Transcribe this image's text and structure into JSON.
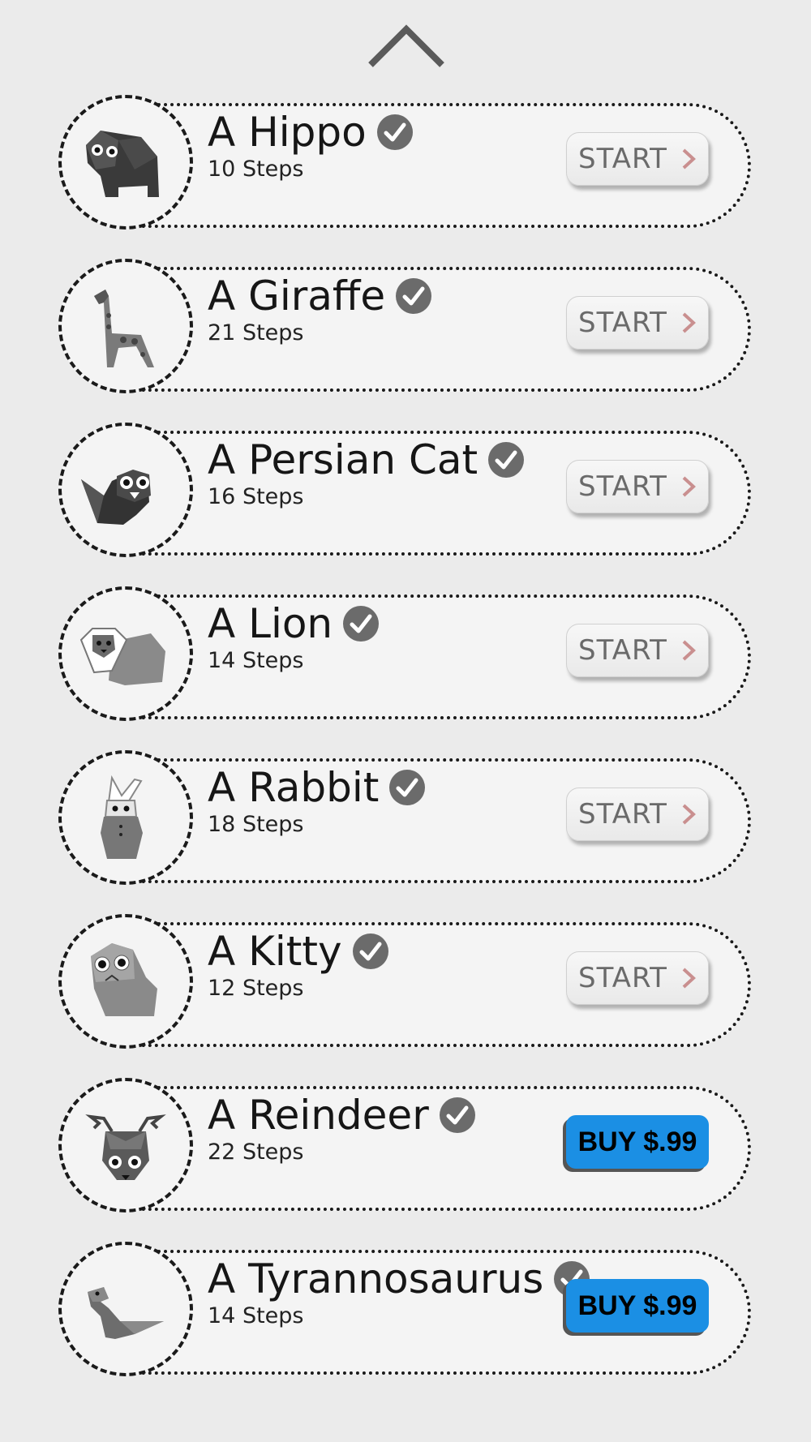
{
  "header": {
    "collapse_icon": "chevron-up-icon"
  },
  "items": [
    {
      "title": "A Hippo",
      "steps": "10 Steps",
      "button": "START",
      "action": "start",
      "icon": "hippo-icon"
    },
    {
      "title": "A Giraffe",
      "steps": "21 Steps",
      "button": "START",
      "action": "start",
      "icon": "giraffe-icon"
    },
    {
      "title": "A Persian Cat",
      "steps": "16 Steps",
      "button": "START",
      "action": "start",
      "icon": "persian-cat-icon"
    },
    {
      "title": "A Lion",
      "steps": "14 Steps",
      "button": "START",
      "action": "start",
      "icon": "lion-icon"
    },
    {
      "title": "A Rabbit",
      "steps": "18 Steps",
      "button": "START",
      "action": "start",
      "icon": "rabbit-icon"
    },
    {
      "title": "A Kitty",
      "steps": "12 Steps",
      "button": "START",
      "action": "start",
      "icon": "kitty-icon"
    },
    {
      "title": "A Reindeer",
      "steps": "22 Steps",
      "button": "BUY $.99",
      "action": "buy",
      "icon": "reindeer-icon"
    },
    {
      "title": "A Tyrannosaurus",
      "steps": "14 Steps",
      "button": "BUY $.99",
      "action": "buy",
      "icon": "tyrannosaurus-icon"
    }
  ],
  "colors": {
    "background": "#ebebeb",
    "card": "#f4f4f4",
    "buy_button": "#1b8fe4",
    "start_arrow": "#c98f8f",
    "check_badge": "#6b6b6b"
  }
}
